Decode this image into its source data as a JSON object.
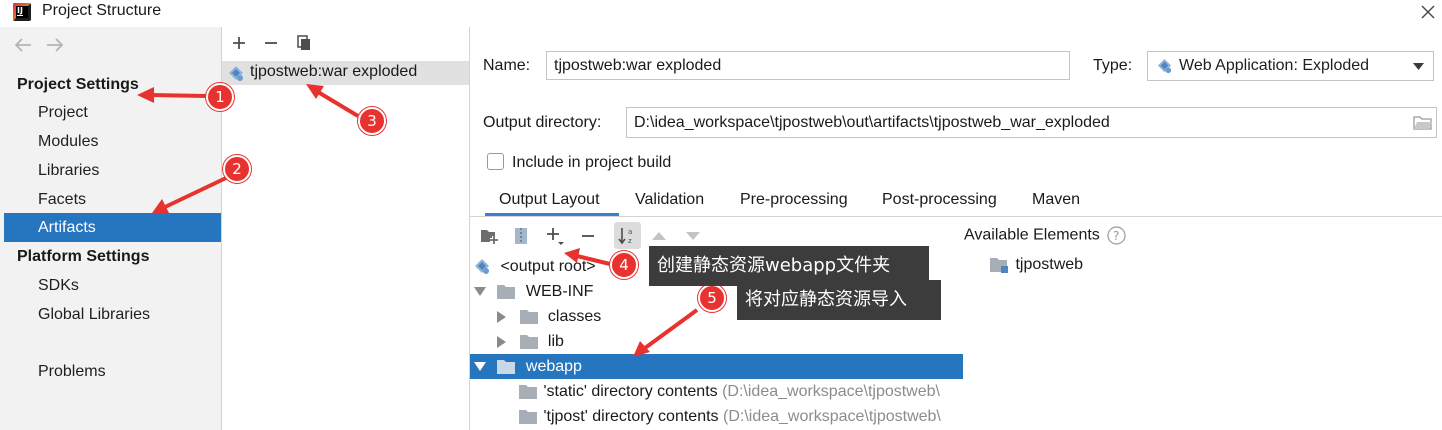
{
  "window": {
    "title": "Project Structure"
  },
  "sidebar": {
    "project_settings_header": "Project Settings",
    "project_items": [
      "Project",
      "Modules",
      "Libraries",
      "Facets",
      "Artifacts"
    ],
    "platform_settings_header": "Platform Settings",
    "platform_items": [
      "SDKs",
      "Global Libraries"
    ],
    "problems": "Problems",
    "selected": "Artifacts"
  },
  "artifacts": {
    "items": [
      "tjpostweb:war exploded"
    ]
  },
  "details": {
    "name_label": "Name:",
    "name_value": "tjpostweb:war exploded",
    "type_label": "Type:",
    "type_value": "Web Application: Exploded",
    "output_dir_label": "Output directory:",
    "output_dir_value": "D:\\idea_workspace\\tjpostweb\\out\\artifacts\\tjpostweb_war_exploded",
    "include_build_label": "Include in project build",
    "include_build_checked": false
  },
  "tabs": [
    "Output Layout",
    "Validation",
    "Pre-processing",
    "Post-processing",
    "Maven"
  ],
  "active_tab": "Output Layout",
  "output_tree": {
    "root": "<output root>",
    "web_inf": "WEB-INF",
    "classes": "classes",
    "lib": "lib",
    "webapp": "webapp",
    "static_contents": "'static' directory contents",
    "static_path": "(D:\\idea_workspace\\tjpostweb\\",
    "tjpost_contents": "'tjpost' directory contents",
    "tjpost_path": "(D:\\idea_workspace\\tjpostweb\\"
  },
  "available": {
    "label": "Available Elements",
    "items": [
      "tjpostweb"
    ]
  },
  "annotations": {
    "badges": [
      "1",
      "2",
      "3",
      "4",
      "5"
    ],
    "tip4": "创建静态资源webapp文件夹",
    "tip5": "将对应静态资源导入"
  },
  "colors": {
    "selection": "#2675bf",
    "annotation_red": "#e8322f",
    "tooltip_bg": "#3c3c3c"
  }
}
